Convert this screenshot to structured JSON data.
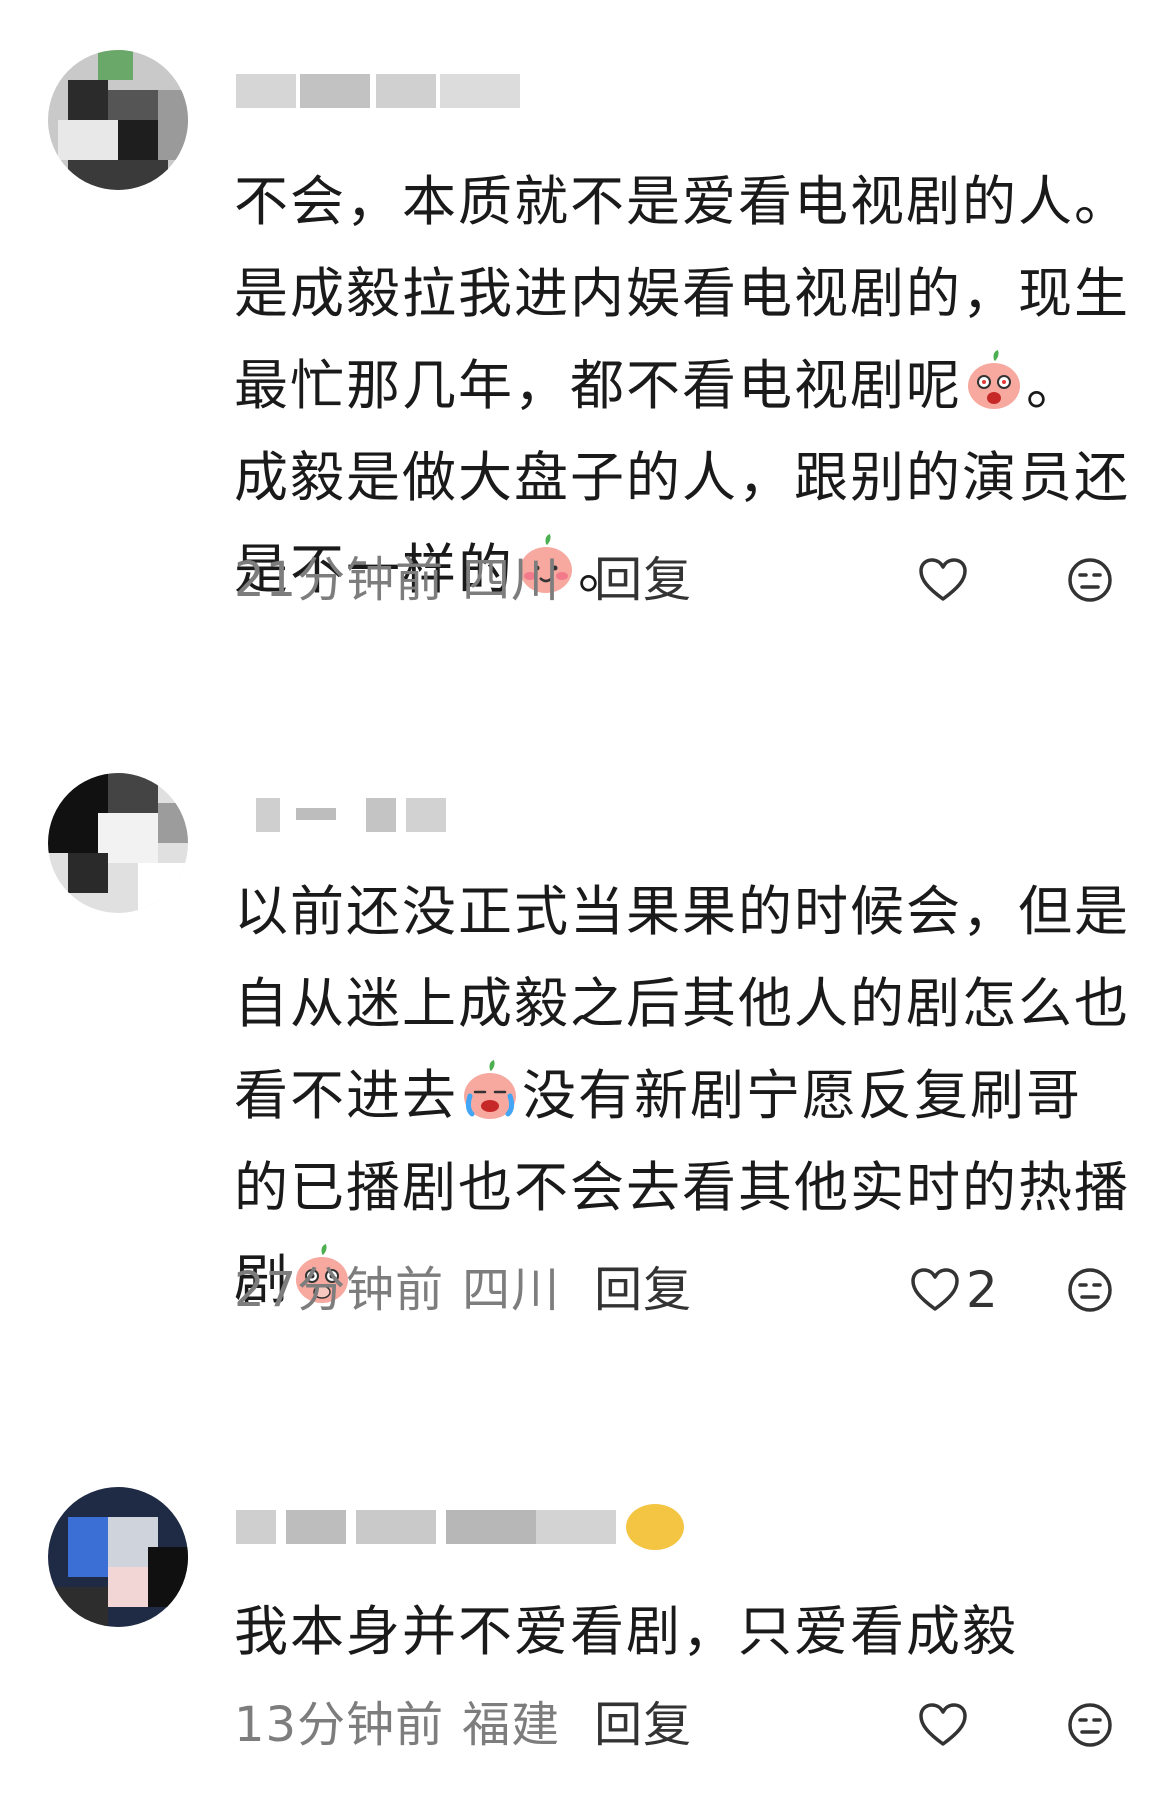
{
  "comments": [
    {
      "text_parts": [
        "不会，本质就不是爱看电视剧的人。是成毅拉我进内娱看电视剧的，现生最忙那几年，都不看电视剧呢",
        "。成毅是做大盘子的人，跟别的演员还是不一样的",
        "。"
      ],
      "emojis": [
        "shocked-peach-icon",
        "smile-peach-icon"
      ],
      "time": "21分钟前",
      "location": "四川",
      "reply_label": "回复",
      "likes": ""
    },
    {
      "text_parts": [
        "以前还没正式当果果的时候会，但是自从迷上成毅之后其他人的剧怎么也看不进去",
        "没有新剧宁愿反复刷哥的已播剧也不会去看其他实时的热播剧",
        ""
      ],
      "emojis": [
        "crying-peach-icon",
        "shy-peach-icon"
      ],
      "time": "27分钟前",
      "location": "四川",
      "reply_label": "回复",
      "likes": "2"
    },
    {
      "text_parts": [
        "我本身并不爱看剧，只爱看成毅",
        "",
        ""
      ],
      "emojis": [],
      "time": "13分钟前",
      "location": "福建",
      "reply_label": "回复",
      "likes": ""
    }
  ],
  "colors": {
    "text": "#1a1a1a",
    "meta": "#7d7d7d",
    "peach": "#f7a9a0"
  }
}
